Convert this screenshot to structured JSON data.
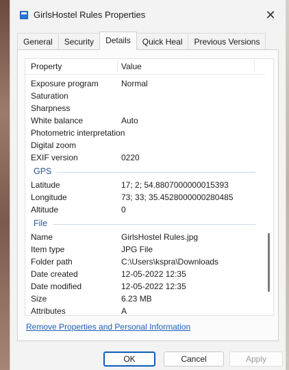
{
  "window": {
    "title": "GirlsHostel Rules Properties"
  },
  "tabs": [
    "General",
    "Security",
    "Details",
    "Quick Heal",
    "Previous Versions"
  ],
  "columns": {
    "property": "Property",
    "value": "Value"
  },
  "rows_top": [
    {
      "k": "Exposure program",
      "v": "Normal"
    },
    {
      "k": "Saturation",
      "v": ""
    },
    {
      "k": "Sharpness",
      "v": ""
    },
    {
      "k": "White balance",
      "v": "Auto"
    },
    {
      "k": "Photometric interpretation",
      "v": ""
    },
    {
      "k": "Digital zoom",
      "v": ""
    },
    {
      "k": "EXIF version",
      "v": "0220"
    }
  ],
  "gps": {
    "label": "GPS",
    "rows": [
      {
        "k": "Latitude",
        "v": "17; 2; 54.8807000000015393"
      },
      {
        "k": "Longitude",
        "v": "73; 33; 35.4528000000280485"
      },
      {
        "k": "Altitude",
        "v": "0"
      }
    ]
  },
  "file": {
    "label": "File",
    "rows": [
      {
        "k": "Name",
        "v": "GirlsHostel Rules.jpg"
      },
      {
        "k": "Item type",
        "v": "JPG File"
      },
      {
        "k": "Folder path",
        "v": "C:\\Users\\kspra\\Downloads"
      },
      {
        "k": "Date created",
        "v": "12-05-2022 12:35"
      },
      {
        "k": "Date modified",
        "v": "12-05-2022 12:35"
      },
      {
        "k": "Size",
        "v": "6.23 MB"
      },
      {
        "k": "Attributes",
        "v": "A"
      }
    ]
  },
  "link": "Remove Properties and Personal Information",
  "buttons": {
    "ok": "OK",
    "cancel": "Cancel",
    "apply": "Apply"
  }
}
